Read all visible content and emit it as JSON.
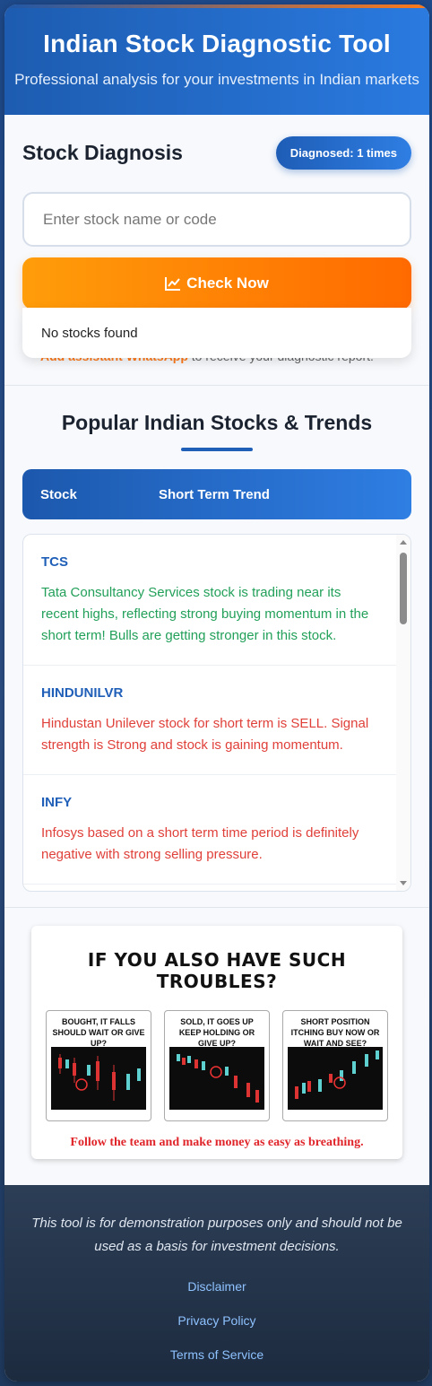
{
  "header": {
    "title": "Indian Stock Diagnostic Tool",
    "subtitle": "Professional analysis for your investments in Indian markets"
  },
  "diagnosis": {
    "title": "Stock Diagnosis",
    "badge": "Diagnosed: 1 times",
    "search_placeholder": "Enter stock name or code",
    "check_button": "Check Now",
    "dropdown_message": "No stocks found",
    "hint_link": "Add assistant WhatsApp",
    "hint_text": " to receive your diagnostic report."
  },
  "popular": {
    "title": "Popular Indian Stocks & Trends",
    "columns": [
      "Stock",
      "Short Term Trend"
    ],
    "rows": [
      {
        "code": "TCS",
        "desc": "Tata Consultancy Services stock is trading near its recent highs, reflecting strong buying momentum in the short term! Bulls are getting stronger in this stock.",
        "trend": "up"
      },
      {
        "code": "HINDUNILVR",
        "desc": "Hindustan Unilever stock for short term is SELL. Signal strength is Strong and stock is gaining momentum.",
        "trend": "down"
      },
      {
        "code": "INFY",
        "desc": "Infosys based on a short term time period is definitely negative with strong selling pressure.",
        "trend": "down"
      }
    ]
  },
  "promo": {
    "title": "IF YOU ALSO HAVE SUCH TROUBLES?",
    "panels": [
      {
        "caption": "BOUGHT, IT FALLS SHOULD WAIT OR GIVE UP?"
      },
      {
        "caption": "SOLD, IT GOES UP KEEP HOLDING OR GIVE UP?"
      },
      {
        "caption": "SHORT POSITION ITCHING BUY NOW OR WAIT AND SEE?"
      }
    ],
    "footer": "Follow the team and make money as easy as breathing."
  },
  "footer": {
    "note": "This tool is for demonstration purposes only and should not be used as a basis for investment decisions.",
    "links": [
      "Disclaimer",
      "Privacy Policy",
      "Terms of Service"
    ]
  },
  "colors": {
    "primary": "#1f5fb8",
    "accent": "#ff7a1a",
    "up": "#22a05a",
    "down": "#e0403a"
  }
}
